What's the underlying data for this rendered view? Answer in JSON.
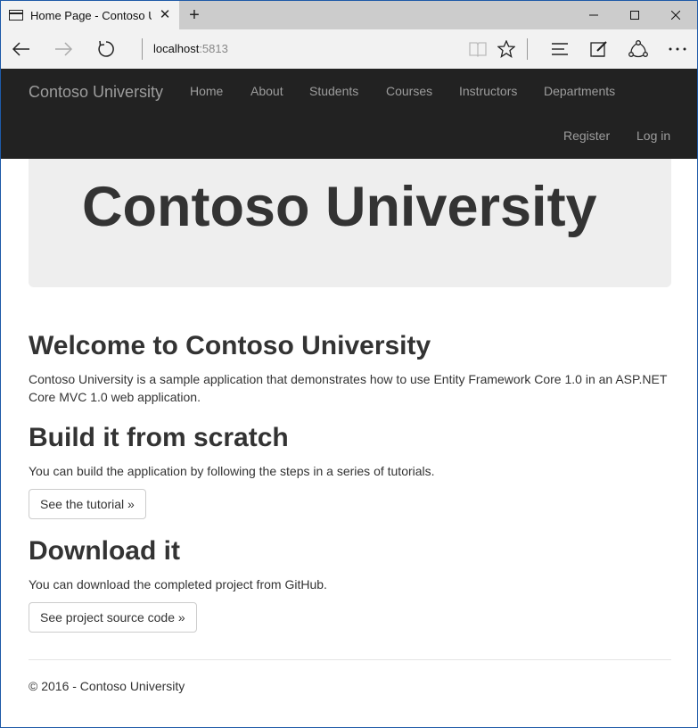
{
  "browser": {
    "tab_title": "Home Page - Contoso U",
    "url_host": "localhost",
    "url_port": ":5813",
    "icons": {
      "tab": "page-icon",
      "close": "close-icon",
      "new_tab": "plus-icon",
      "back": "back-arrow-icon",
      "forward": "forward-arrow-icon",
      "refresh": "refresh-icon",
      "reading": "reading-view-icon",
      "favorite": "star-icon",
      "hub": "hub-icon",
      "note": "web-note-icon",
      "share": "share-icon",
      "more": "more-icon"
    }
  },
  "navbar": {
    "brand": "Contoso University",
    "links": [
      "Home",
      "About",
      "Students",
      "Courses",
      "Instructors",
      "Departments"
    ],
    "right_links": [
      "Register",
      "Log in"
    ]
  },
  "jumbotron": {
    "title": "Contoso University"
  },
  "sections": [
    {
      "heading": "Welcome to Contoso University",
      "text": "Contoso University is a sample application that demonstrates how to use Entity Framework Core 1.0 in an ASP.NET Core MVC 1.0 web application."
    },
    {
      "heading": "Build it from scratch",
      "text": "You can build the application by following the steps in a series of tutorials.",
      "button": "See the tutorial »"
    },
    {
      "heading": "Download it",
      "text": "You can download the completed project from GitHub.",
      "button": "See project source code »"
    }
  ],
  "footer": {
    "text": "© 2016 - Contoso University"
  }
}
